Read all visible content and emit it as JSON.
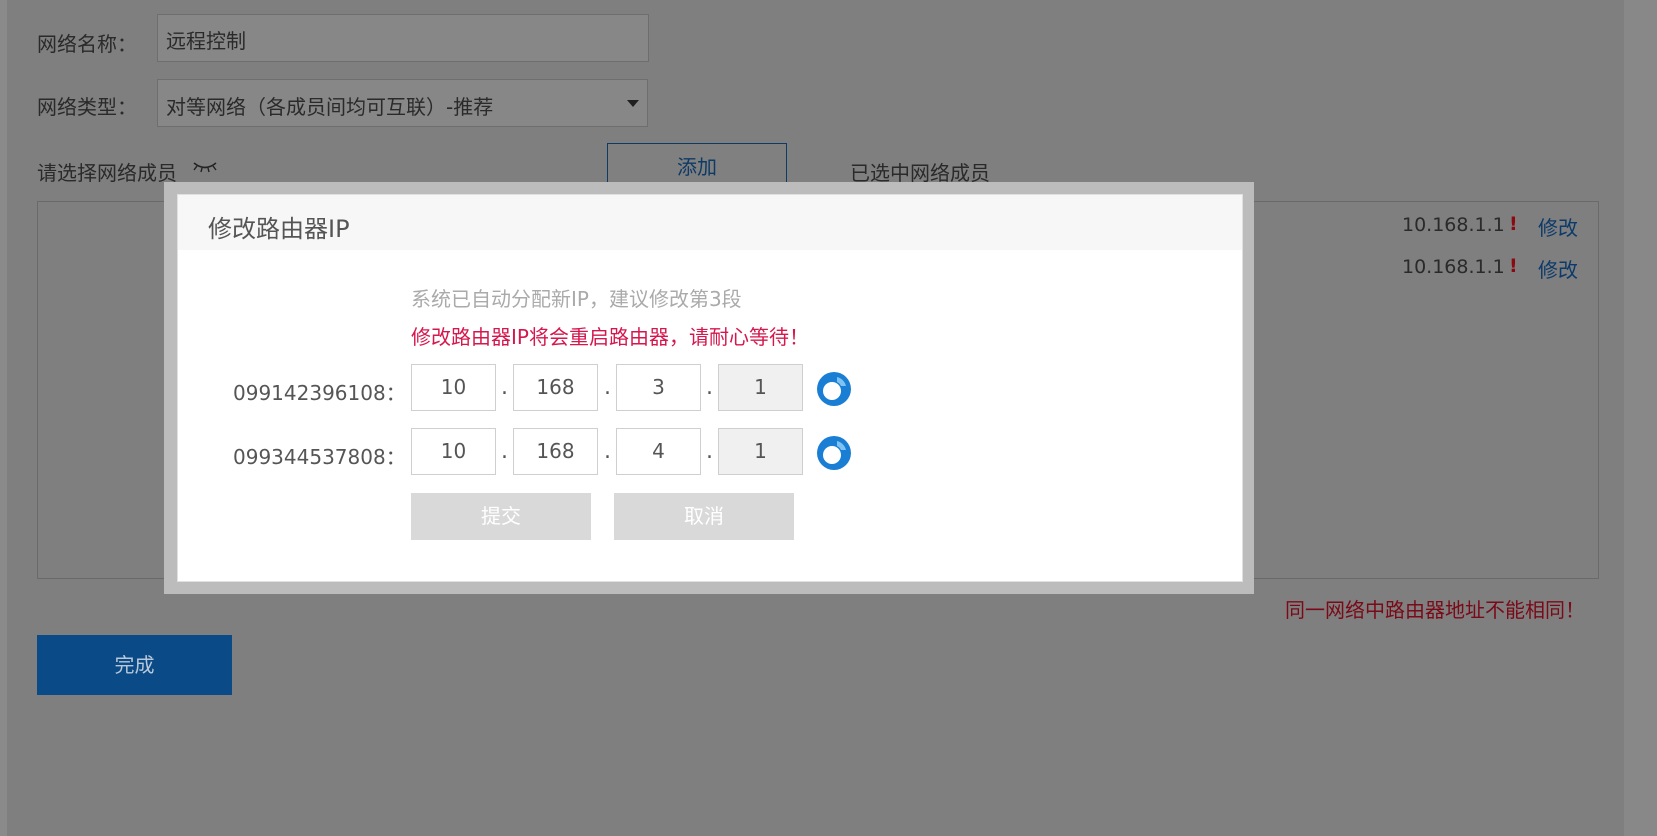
{
  "form": {
    "name_label": "网络名称：",
    "name_value": "远程控制",
    "type_label": "网络类型：",
    "type_value": "对等网络（各成员间均可互联）-推荐",
    "choose_members_label": "请选择网络成员",
    "add_label": "添加",
    "selected_members_label": "已选中网络成员",
    "members": [
      {
        "ip": "10.168.1.1",
        "warn": "!",
        "edit": "修改"
      },
      {
        "ip": "10.168.1.1",
        "warn": "!",
        "edit": "修改"
      }
    ],
    "duplicate_warning": "同一网络中路由器地址不能相同！",
    "done_label": "完成"
  },
  "modal": {
    "title": "修改路由器IP",
    "hint": "系统已自动分配新IP，建议修改第3段",
    "warning": "修改路由器IP将会重启路由器，请耐心等待！",
    "routers": [
      {
        "label": "099142396108：",
        "octets": [
          "10",
          "168",
          "3",
          "1"
        ]
      },
      {
        "label": "099344537808：",
        "octets": [
          "10",
          "168",
          "4",
          "1"
        ]
      }
    ],
    "dot": ".",
    "submit_label": "提交",
    "cancel_label": "取消"
  },
  "colors": {
    "overlay_bg": "#7f7f7f",
    "accent_blue": "#0a4a86",
    "warning_red": "#d6174d",
    "refresh_icon_blue": "#1a7fd4"
  },
  "icons": {
    "hidden_eye": "eye-closed-icon",
    "refresh": "refresh-icon"
  }
}
